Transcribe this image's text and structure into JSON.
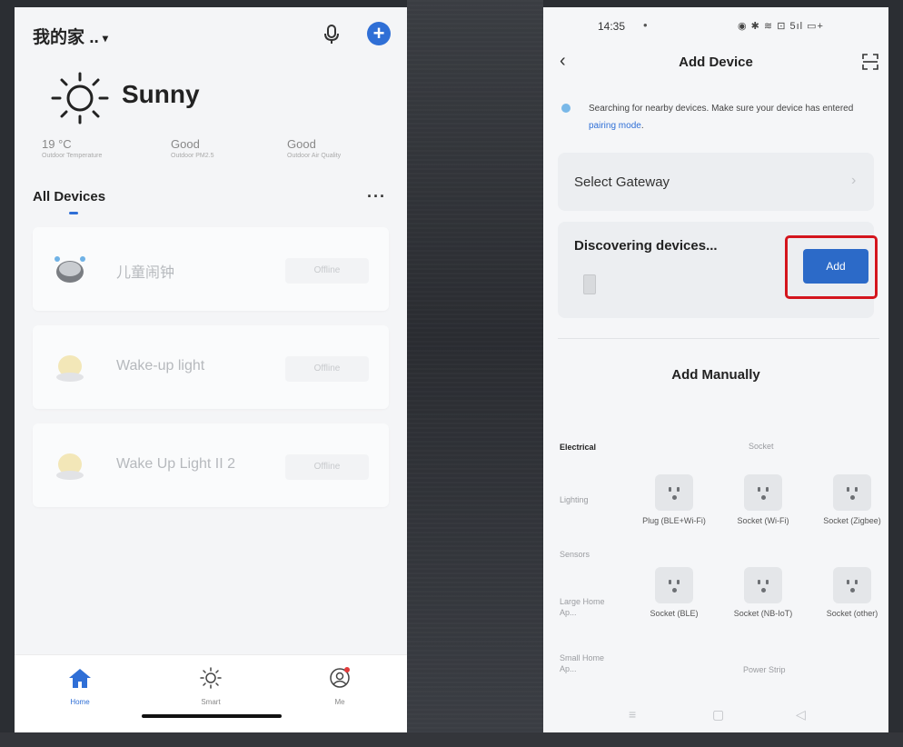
{
  "left": {
    "home_name": "我的家 ..",
    "weather": "Sunny",
    "stats": [
      {
        "value": "19 °C",
        "label": "Outdoor Temperature"
      },
      {
        "value": "Good",
        "label": "Outdoor PM2.5"
      },
      {
        "value": "Good",
        "label": "Outdoor Air Quality"
      }
    ],
    "section_title": "All Devices",
    "more_label": "···",
    "devices": [
      {
        "name": "儿童闹钟",
        "status": "Offline",
        "icon": "alarm-clock-icon"
      },
      {
        "name": "Wake-up light",
        "status": "Offline",
        "icon": "lamp-icon"
      },
      {
        "name": "Wake Up Light II 2",
        "status": "Offline",
        "icon": "lamp-icon"
      }
    ],
    "tabs": [
      {
        "label": "Home",
        "icon": "home-icon",
        "active": true
      },
      {
        "label": "Smart",
        "icon": "sun-icon",
        "active": false
      },
      {
        "label": "Me",
        "icon": "profile-icon",
        "active": false
      }
    ]
  },
  "right": {
    "status_time": "14:35",
    "status_icons": "◉ ✱ ≋ ⊡ 5ıl ▭+",
    "title": "Add Device",
    "search_tip": "Searching for nearby devices. Make sure your device has entered",
    "pairing_link": "pairing mode",
    "select_gateway": "Select Gateway",
    "discovering": "Discovering devices...",
    "add_label": "Add",
    "add_manually": "Add Manually",
    "categories": [
      "Electrical",
      "Lighting",
      "Sensors",
      "Large Home Ap...",
      "Small Home Ap..."
    ],
    "subcategory": "Socket",
    "products": [
      {
        "name": "Plug (BLE+Wi-Fi)"
      },
      {
        "name": "Socket (Wi-Fi)"
      },
      {
        "name": "Socket (Zigbee)"
      },
      {
        "name": "Socket (BLE)"
      },
      {
        "name": "Socket (NB-IoT)"
      },
      {
        "name": "Socket (other)"
      }
    ],
    "power_strip": "Power Strip",
    "accent_color": "#2c6ac8",
    "highlight_color": "#d4151d"
  }
}
